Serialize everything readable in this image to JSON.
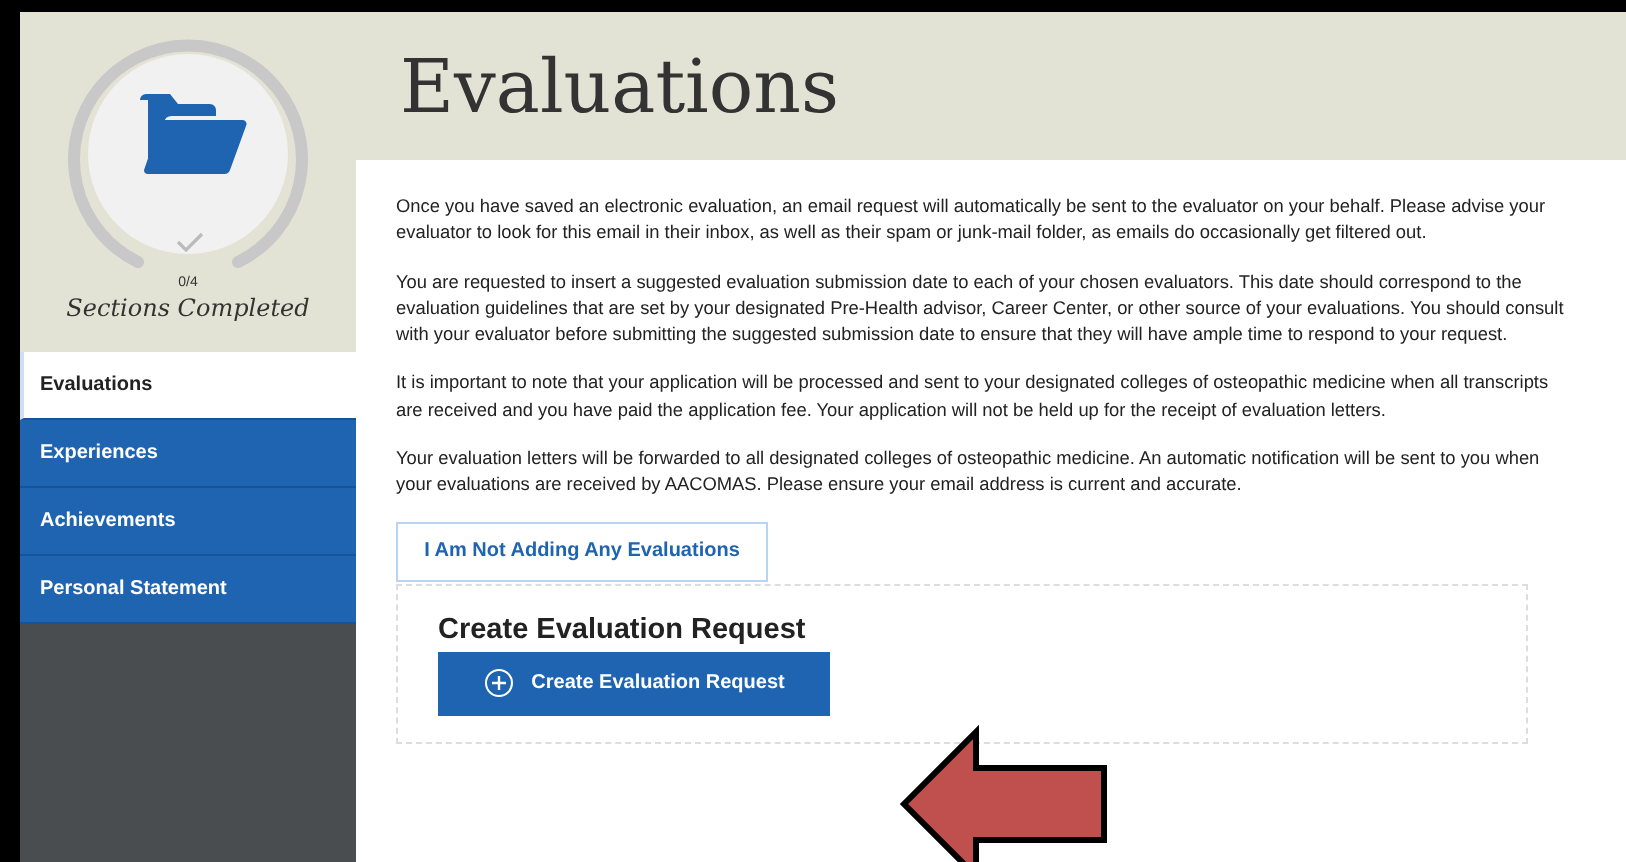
{
  "sidebar": {
    "progress": {
      "count": "0/4",
      "label": "Sections Completed"
    },
    "items": [
      {
        "label": "Evaluations",
        "selected": true
      },
      {
        "label": "Experiences",
        "selected": false
      },
      {
        "label": "Achievements",
        "selected": false
      },
      {
        "label": "Personal Statement",
        "selected": false
      }
    ]
  },
  "page": {
    "title": "Evaluations",
    "paragraphs": [
      "Once you have saved an electronic evaluation, an email request will automatically be sent to the evaluator on your behalf. Please advise your evaluator to look for this email in their inbox, as well as their spam or junk-mail folder, as emails do occasionally get filtered out.",
      "You are requested to insert a suggested evaluation submission date to each of your chosen evaluators. This date should correspond to the evaluation guidelines that are set by your designated Pre-Health advisor, Career Center, or other source of your evaluations. You should consult with your evaluator before submitting the suggested submission date to ensure that they will have ample time to respond to your request.",
      "It is important to note that your application will be processed and sent to your designated colleges of osteopathic medicine when all transcripts are received and you have paid the application fee. Your application will not be held up for the receipt of evaluation letters.",
      "Your evaluation letters will be forwarded to all designated colleges of osteopathic medicine. An automatic notification will be sent to you when your evaluations are received by AACOMAS. Please ensure your email address is current and accurate."
    ],
    "none_button": "I Am Not Adding Any Evaluations",
    "request": {
      "heading": "Create Evaluation Request",
      "button": "Create Evaluation Request"
    }
  }
}
